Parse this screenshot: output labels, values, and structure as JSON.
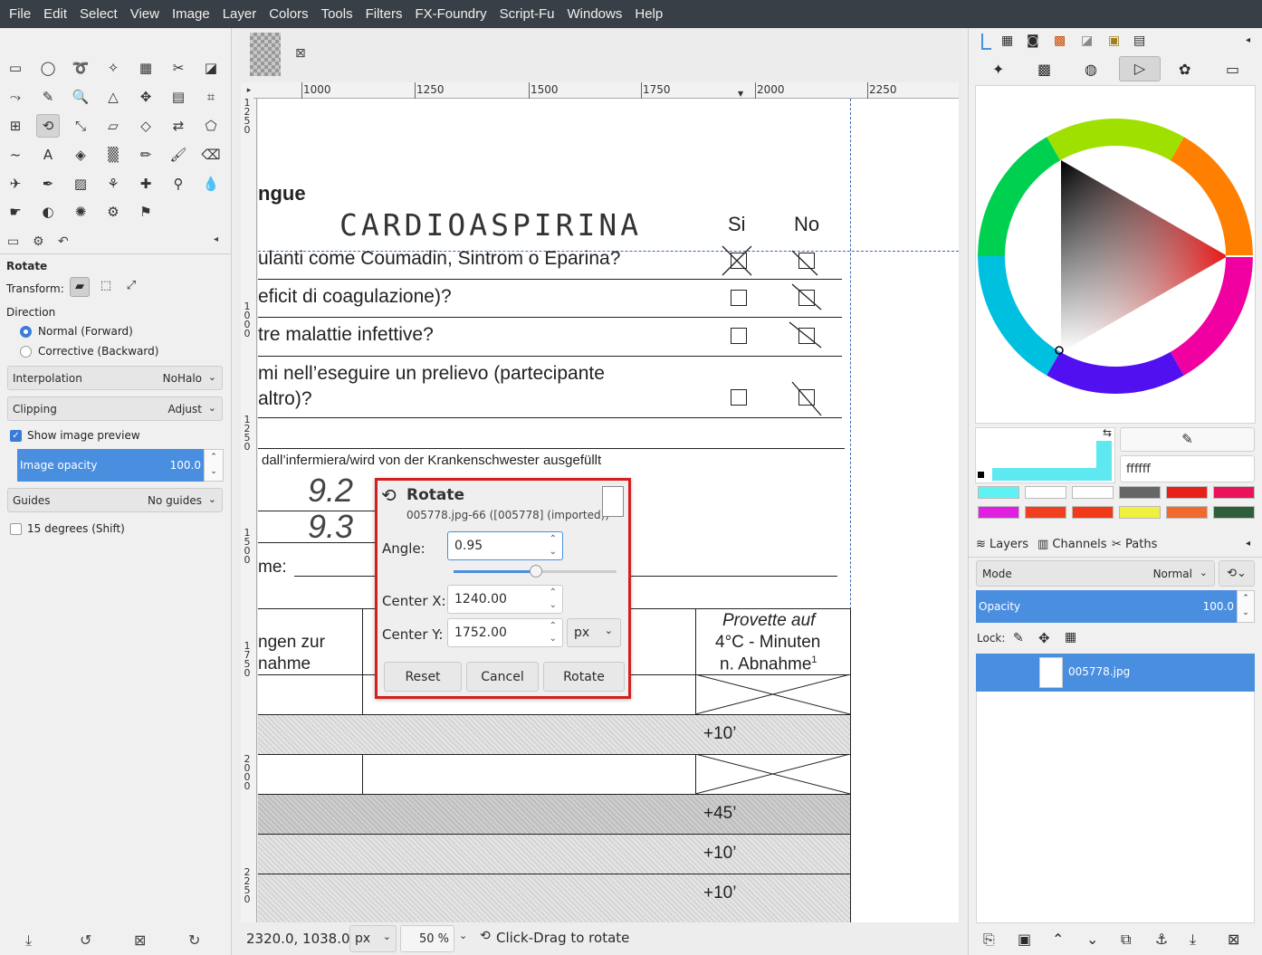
{
  "menu": [
    "File",
    "Edit",
    "Select",
    "View",
    "Image",
    "Layer",
    "Colors",
    "Tools",
    "Filters",
    "FX-Foundry",
    "Script-Fu",
    "Windows",
    "Help"
  ],
  "tool_options": {
    "title": "Rotate",
    "transform_label": "Transform:",
    "direction_label": "Direction",
    "direction_normal": "Normal (Forward)",
    "direction_corrective": "Corrective (Backward)",
    "interpolation_label": "Interpolation",
    "interpolation_value": "NoHalo",
    "clipping_label": "Clipping",
    "clipping_value": "Adjust",
    "show_preview_label": "Show image preview",
    "opacity_label": "Image opacity",
    "opacity_value": "100.0",
    "guides_label": "Guides",
    "guides_value": "No guides",
    "fifteen_deg_label": "15 degrees (Shift)"
  },
  "ruler": {
    "h_ticks": [
      "1000",
      "1250",
      "1500",
      "1750",
      "2000",
      "2250"
    ],
    "v_ticks": [
      "1250",
      "1000",
      "1250",
      "1500",
      "1750",
      "2000",
      "2250"
    ]
  },
  "document": {
    "heading": "ngue",
    "handwritten": "CARDIOASPIRINA",
    "col_si": "Si",
    "col_no": "No",
    "q1": "ulanti come Coumadin, Sintrom o Eparina?",
    "q2": "eficit di coagulazione)?",
    "q3": "tre malattie infettive?",
    "q4a": "mi nell’eseguire un prelievo (partecipante",
    "q4b": "altro)?",
    "filled_by": "dall’infermiera/wird von der Krankenschwester ausgefüllt",
    "hand1": "9.2",
    "hand2": "9.3",
    "name_label": "me:",
    "left_col_a": "ngen zur",
    "left_col_b": "nahme",
    "provette_a": "Provette auf",
    "provette_b": "4°C - Minuten",
    "provette_c": "n. Abnahme",
    "provette_sup": "1",
    "row1": "+10’",
    "row2": "+45’",
    "row3": "+10’",
    "row4": "+10’"
  },
  "status": {
    "coords": "2320.0, 1038.0",
    "unit": "px",
    "zoom": "50 %",
    "message": "Click-Drag to rotate"
  },
  "dialog": {
    "title": "Rotate",
    "subtitle": "005778.jpg-66 ([005778] (imported))",
    "angle_label": "Angle:",
    "angle_value": "0.95",
    "center_x_label": "Center X:",
    "center_x_value": "1240.00",
    "center_y_label": "Center Y:",
    "center_y_value": "1752.00",
    "unit": "px",
    "reset": "Reset",
    "cancel": "Cancel",
    "rotate": "Rotate"
  },
  "colors": {
    "hex_value": "ffffff",
    "fg_color": "#5ee8f0",
    "swatches": [
      "#5ef2f2",
      "#ffffff",
      "#ffffff",
      "#666666",
      "#e8201a",
      "#e8135a",
      "#e020e0",
      "#f04020",
      "#f03a18",
      "#f0f040",
      "#f06a30",
      "#2e5e3a"
    ]
  },
  "layers": {
    "tab_layers": "Layers",
    "tab_channels": "Channels",
    "tab_paths": "Paths",
    "mode_label": "Mode",
    "mode_value": "Normal",
    "opacity_label": "Opacity",
    "opacity_value": "100.0",
    "lock_label": "Lock:",
    "layer_name": "005778.jpg"
  }
}
